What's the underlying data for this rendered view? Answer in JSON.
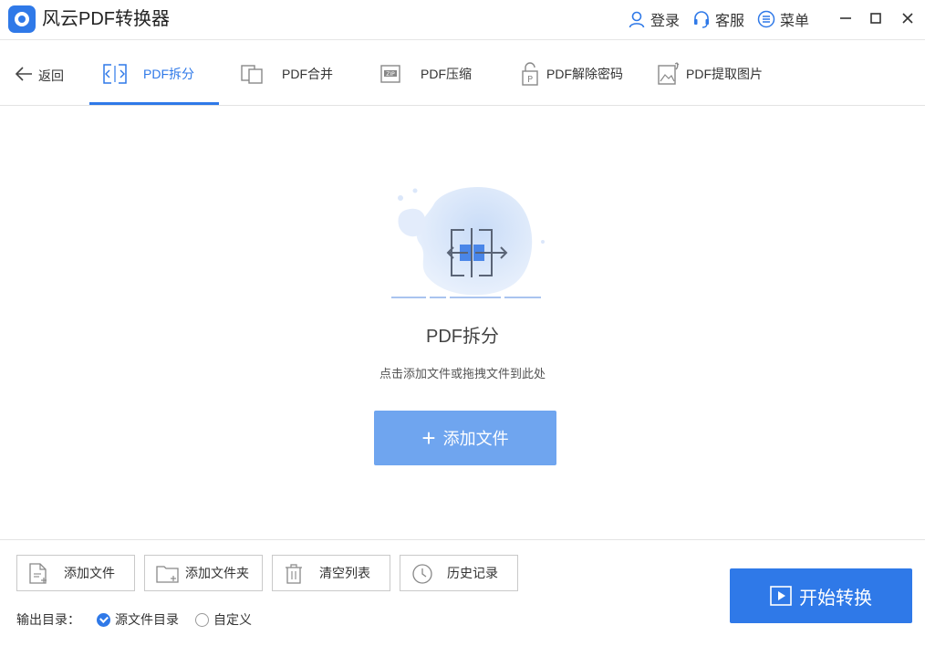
{
  "app": {
    "title": "风云PDF转换器",
    "accent_color": "#2f79e8",
    "button_light_color": "#6fa5ef"
  },
  "header": {
    "actions": [
      {
        "icon": "user-icon",
        "label": "登录"
      },
      {
        "icon": "headset-icon",
        "label": "客服"
      },
      {
        "icon": "menu-icon",
        "label": "菜单"
      }
    ],
    "window_controls": [
      "minimize-icon",
      "maximize-icon",
      "close-icon"
    ]
  },
  "nav": {
    "back_label": "返回",
    "tabs": [
      {
        "icon": "split-icon",
        "label": "PDF拆分",
        "active": true
      },
      {
        "icon": "merge-icon",
        "label": "PDF合并",
        "active": false
      },
      {
        "icon": "zip-icon",
        "label": "PDF压缩",
        "active": false
      },
      {
        "icon": "unlock-icon",
        "label": "PDF解除密码",
        "active": false
      },
      {
        "icon": "image-extract-icon",
        "label": "PDF提取图片",
        "active": false
      }
    ]
  },
  "main": {
    "title": "PDF拆分",
    "subtitle": "点击添加文件或拖拽文件到此处",
    "add_button_label": "添加文件"
  },
  "toolbar": {
    "buttons": [
      {
        "icon": "file-add-icon",
        "label": "添加文件"
      },
      {
        "icon": "folder-add-icon",
        "label": "添加文件夹"
      },
      {
        "icon": "trash-icon",
        "label": "清空列表"
      },
      {
        "icon": "clock-icon",
        "label": "历史记录"
      }
    ]
  },
  "output": {
    "label": "输出目录：",
    "options": [
      {
        "label": "源文件目录",
        "checked": true
      },
      {
        "label": "自定义",
        "checked": false
      }
    ]
  },
  "start_button_label": "开始转换"
}
